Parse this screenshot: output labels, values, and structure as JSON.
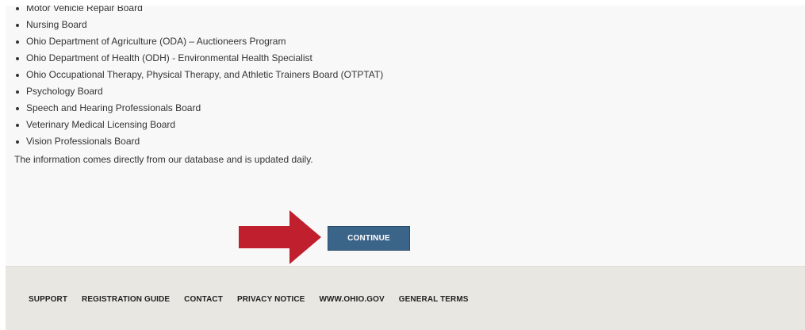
{
  "boards": [
    "Motor Vehicle Repair Board",
    "Nursing Board",
    "Ohio Department of Agriculture (ODA) – Auctioneers Program",
    "Ohio Department of Health (ODH) - Environmental Health Specialist",
    "Ohio Occupational Therapy, Physical Therapy, and Athletic Trainers Board (OTPTAT)",
    "Psychology Board",
    "Speech and Hearing Professionals Board",
    "Veterinary Medical Licensing Board",
    "Vision Professionals Board"
  ],
  "info_text": "The information comes directly from our database and is updated daily.",
  "continue_label": "CONTINUE",
  "footer_links": [
    "SUPPORT",
    "REGISTRATION GUIDE",
    "CONTACT",
    "PRIVACY NOTICE",
    "WWW.OHIO.GOV",
    "GENERAL TERMS"
  ],
  "colors": {
    "arrow": "#c0202e",
    "button": "#3b6489",
    "footer_bg": "#e8e7e2",
    "content_bg": "#f8f8f8"
  },
  "icons": {
    "arrow": "right-arrow-icon"
  }
}
